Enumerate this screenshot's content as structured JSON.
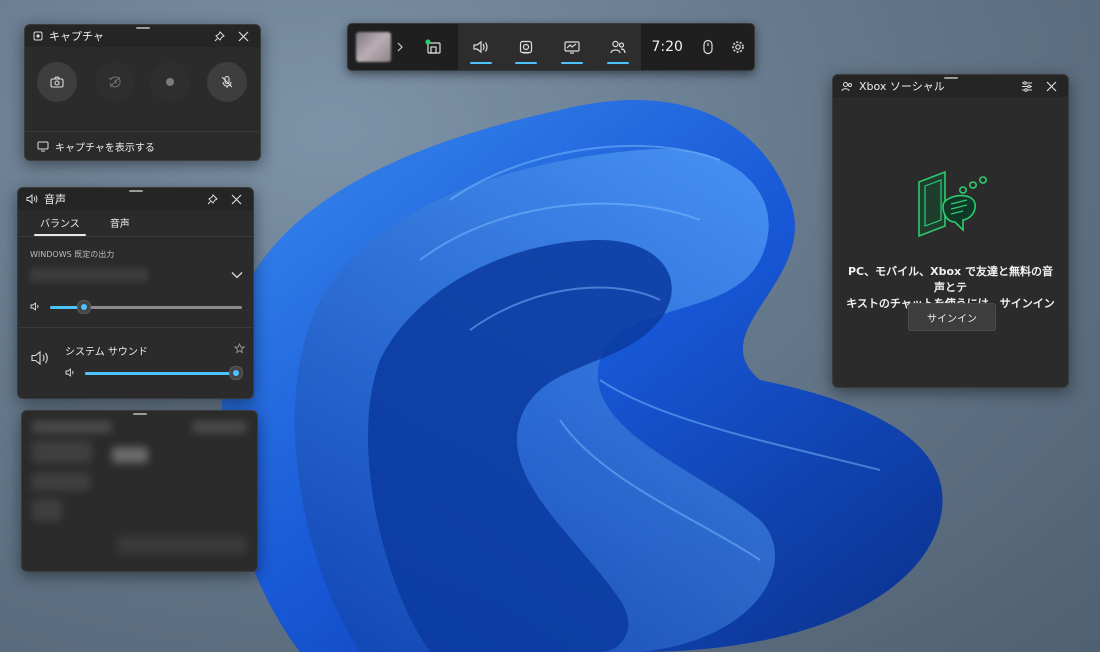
{
  "gamebar": {
    "time": "7:20",
    "accent": "#4cc2ff",
    "icons": [
      "widget-menu-icon",
      "audio-icon",
      "capture-icon",
      "performance-icon",
      "social-icon",
      "mouse-icon",
      "settings-icon"
    ]
  },
  "capture": {
    "title": "キャプチャ",
    "footer": "キャプチャを表示する"
  },
  "audio": {
    "title": "音声",
    "tabs": [
      "バランス",
      "音声"
    ],
    "section_label": "WINDOWS 既定の出力",
    "master_volume": 0.15,
    "app_name": "システム サウンド",
    "app_volume": 1.0
  },
  "social": {
    "title": "Xbox ソーシャル",
    "message_line1": "PC、モバイル、Xbox で友達と無料の音声とテ",
    "message_line2": "キストのチャットを使うには、サインインしてくだ...",
    "signin": "サインイン",
    "accent": "#2ecc71"
  }
}
